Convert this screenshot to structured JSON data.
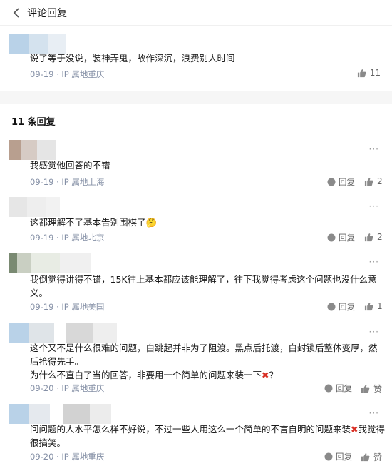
{
  "header": {
    "back_icon": "chevron-left-icon",
    "title": "评论回复"
  },
  "main_comment": {
    "text": "说了等于没说，装神弄鬼，故作深沉，浪费别人时间",
    "date": "09-19",
    "ip": "IP 属地重庆",
    "likes": "11"
  },
  "replies_header": "11 条回复",
  "replies": [
    {
      "text": "我感觉他回答的不错",
      "date": "09-19",
      "ip": "IP 属地上海",
      "reply_label": "回复",
      "likes": "2"
    },
    {
      "text": "这都理解不了基本告别围棋了🤔",
      "date": "09-19",
      "ip": "IP 属地北京",
      "reply_label": "回复",
      "likes": "2"
    },
    {
      "text": "我倒觉得讲得不错，15K往上基本都应该能理解了，往下我觉得考虑这个问题也没什么意义。",
      "date": "09-19",
      "ip": "IP 属地美国",
      "reply_label": "回复",
      "likes": "1"
    },
    {
      "text": "这个又不是什么很难的问题，白跳起并非为了阻渡。黑点后托渡，白封锁后整体变厚，然后抢得先手。",
      "text2": "为什么不直白了当的回答，非要用一个简单的问题来装一下",
      "text2_end": "？",
      "date": "09-20",
      "ip": "IP 属地重庆",
      "reply_label": "回复",
      "likes": "赞"
    },
    {
      "text": "问问题的人水平怎么样不好说，不过一些人用这么一个简单的不言自明的问题来装",
      "text_end": "我觉得很搞笑。",
      "date": "09-20",
      "ip": "IP 属地重庆",
      "reply_label": "回复",
      "likes": "赞"
    }
  ],
  "separator": "·",
  "more_icon": "···",
  "x_emoji": "✖",
  "colors": {
    "meta": "#8590a6",
    "gap": "#f6f6f6",
    "x_emoji": "#d93025"
  }
}
